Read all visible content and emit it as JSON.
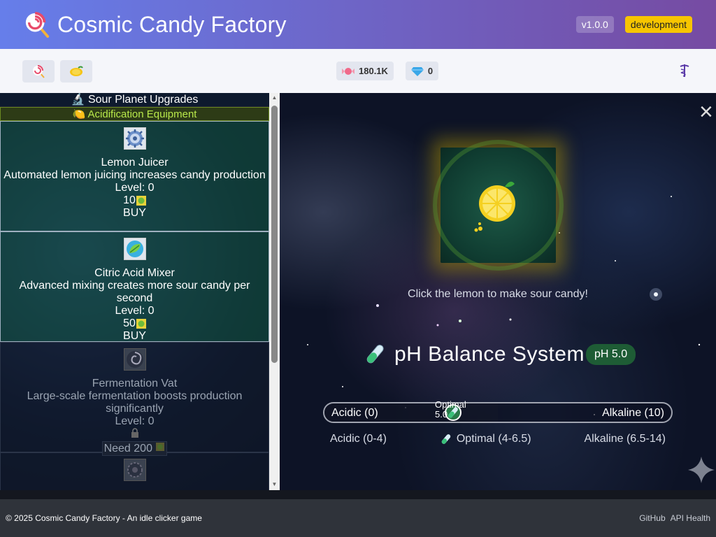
{
  "header": {
    "title": "Cosmic Candy Factory",
    "version": "v1.0.0",
    "environment": "development",
    "logo_icon": "lollipop-icon"
  },
  "toolbar": {
    "planets": [
      {
        "icon": "lollipop-icon",
        "name": "candy-planet"
      },
      {
        "icon": "lemon-icon",
        "name": "sour-planet"
      }
    ],
    "currencies": [
      {
        "icon": "candy-icon",
        "value": "180.1K"
      },
      {
        "icon": "gem-icon",
        "value": "0"
      }
    ],
    "settings_icon": "caduceus-icon"
  },
  "sidebar": {
    "panel_title": "🔬 Sour Planet Upgrades",
    "category_title": "🍋 Acidification Equipment",
    "upgrades": [
      {
        "name": "Lemon Juicer",
        "description": "Automated lemon juicing increases candy production",
        "level": "Level: 0",
        "cost": "10",
        "action": "BUY",
        "state": "available",
        "icon": "gear-icon"
      },
      {
        "name": "Citric Acid Mixer",
        "description": "Advanced mixing creates more sour candy per second",
        "level": "Level: 0",
        "cost": "50",
        "action": "BUY",
        "state": "available",
        "icon": "leaf-orb-icon"
      },
      {
        "name": "Fermentation Vat",
        "description": "Large-scale fermentation boosts production significantly",
        "level": "Level: 0",
        "cost": "Need 200",
        "action": "",
        "state": "locked",
        "icon": "swirl-icon"
      }
    ]
  },
  "game": {
    "click_hint": "Click the lemon to make sour candy!",
    "ph_title": "pH Balance System",
    "ph_badge": "pH 5.0",
    "ph_value": 5.0,
    "slider_left": "Acidic (0)",
    "slider_right": "Alkaline (10)",
    "slider_optimal_label": "Optimal",
    "slider_optimal_value": "5.0",
    "legend": {
      "acidic": "Acidic (0-4)",
      "optimal": "Optimal (4-6.5)",
      "alkaline": "Alkaline (6.5-14)"
    }
  },
  "footer": {
    "copyright": "© 2025 Cosmic Candy Factory - An idle clicker game",
    "links": [
      "GitHub",
      "API Health"
    ]
  },
  "colors": {
    "header_gradient_start": "#667eea",
    "header_gradient_end": "#764ba2",
    "env_badge": "#f7c500",
    "ph_badge": "#1e5c35",
    "category_text": "#b8e84a"
  }
}
